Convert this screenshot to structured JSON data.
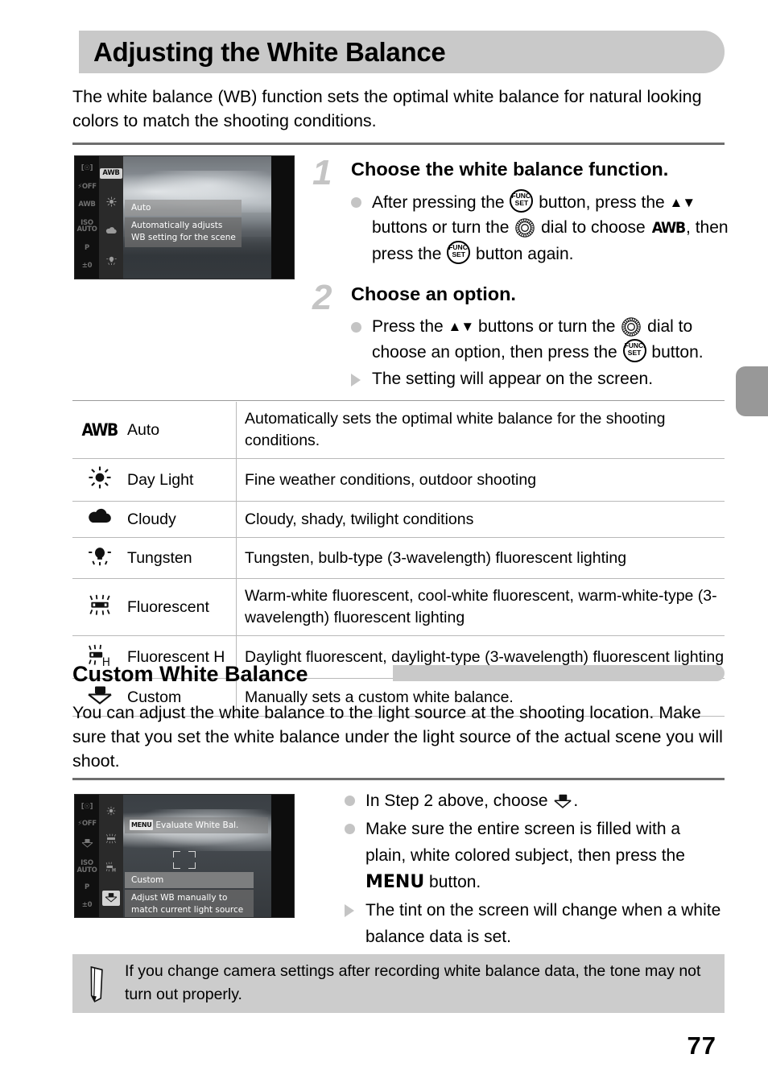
{
  "header": {
    "title": "Adjusting the White Balance",
    "intro": "The white balance (WB) function sets the optimal white balance for natural looking colors to match the shooting conditions."
  },
  "camera_screen_1": {
    "left_column_icons": [
      "metering-icon",
      "flash-off-icon",
      "awb-icon",
      "iso-auto-icon",
      "P",
      "±0"
    ],
    "left_column_labels": [
      "[*]",
      "OFF",
      "AWB",
      "ISO AUTO",
      "P",
      "±0"
    ],
    "selected_column_labels": [
      "AWB",
      "daylight-icon",
      "cloudy-icon",
      "tungsten-icon"
    ],
    "highlighted": "AWB",
    "option_label": "Auto",
    "option_description_line1": "Automatically adjusts",
    "option_description_line2": "WB setting for the scene"
  },
  "camera_screen_2": {
    "left_column_labels": [
      "[*]",
      "OFF",
      "custom-icon",
      "ISO AUTO",
      "P",
      "±0"
    ],
    "selected_column_labels": [
      "daylight-icon",
      "fluorescent-icon",
      "fluorescent-h-icon",
      "custom-icon"
    ],
    "highlighted": "custom-icon",
    "menu_chip": "MENU",
    "menu_bar_text": "Evaluate White Bal.",
    "option_label": "Custom",
    "option_description_line1": "Adjust WB manually to",
    "option_description_line2": "match current light source"
  },
  "steps": [
    {
      "number": "1",
      "title": "Choose the white balance function.",
      "lines": [
        {
          "marker": "dot",
          "segments": [
            {
              "t": "text",
              "v": "After pressing the "
            },
            {
              "t": "func",
              "v": "FUNC./SET"
            },
            {
              "t": "text",
              "v": " button, press the "
            },
            {
              "t": "arrows",
              "v": "▲▼"
            },
            {
              "t": "text",
              "v": " buttons or turn the "
            },
            {
              "t": "dial",
              "v": "control-dial"
            },
            {
              "t": "text",
              "v": " dial to choose "
            },
            {
              "t": "awb",
              "v": "AWB"
            },
            {
              "t": "text",
              "v": ", then press the "
            },
            {
              "t": "func",
              "v": "FUNC./SET"
            },
            {
              "t": "text",
              "v": " button again."
            }
          ]
        }
      ]
    },
    {
      "number": "2",
      "title": "Choose an option.",
      "lines": [
        {
          "marker": "dot",
          "segments": [
            {
              "t": "text",
              "v": "Press the "
            },
            {
              "t": "arrows",
              "v": "▲▼"
            },
            {
              "t": "text",
              "v": " buttons or turn the "
            },
            {
              "t": "dial",
              "v": "control-dial"
            },
            {
              "t": "text",
              "v": " dial to choose an option, then press the "
            },
            {
              "t": "func",
              "v": "FUNC./SET"
            },
            {
              "t": "text",
              "v": " button."
            }
          ]
        },
        {
          "marker": "triangle",
          "segments": [
            {
              "t": "text",
              "v": "The setting will appear on the screen."
            }
          ]
        }
      ]
    }
  ],
  "wb_table": {
    "rows": [
      {
        "icon": "awb-icon",
        "name": "Auto",
        "desc": "Automatically sets the optimal white balance for the shooting conditions."
      },
      {
        "icon": "daylight-icon",
        "name": "Day Light",
        "desc": "Fine weather conditions, outdoor shooting"
      },
      {
        "icon": "cloudy-icon",
        "name": "Cloudy",
        "desc": "Cloudy, shady, twilight conditions"
      },
      {
        "icon": "tungsten-icon",
        "name": "Tungsten",
        "desc": "Tungsten, bulb-type (3-wavelength) fluorescent lighting"
      },
      {
        "icon": "fluorescent-icon",
        "name": "Fluorescent",
        "desc": "Warm-white fluorescent, cool-white fluorescent, warm-white-type (3-wavelength) fluorescent lighting"
      },
      {
        "icon": "fluorescent-h-icon",
        "name": "Fluorescent H",
        "desc": "Daylight fluorescent, daylight-type (3-wavelength) fluorescent lighting"
      },
      {
        "icon": "custom-icon",
        "name": "Custom",
        "desc": "Manually sets a custom white balance."
      }
    ]
  },
  "section2": {
    "heading": "Custom White Balance",
    "paragraph": "You can adjust the white balance to the light source at the shooting location. Make sure that you set the white balance under the light source of the actual scene you will shoot.",
    "bullets": [
      {
        "marker": "dot",
        "segments": [
          {
            "t": "text",
            "v": "In Step 2 above, choose "
          },
          {
            "t": "custom",
            "v": "custom-wb-icon"
          },
          {
            "t": "text",
            "v": "."
          }
        ]
      },
      {
        "marker": "dot",
        "segments": [
          {
            "t": "text",
            "v": "Make sure the entire screen is filled with a plain, white colored subject, then press the "
          },
          {
            "t": "menu",
            "v": "MENU"
          },
          {
            "t": "text",
            "v": " button."
          }
        ]
      },
      {
        "marker": "triangle",
        "segments": [
          {
            "t": "text",
            "v": "The tint on the screen will change when a white balance data is set."
          }
        ]
      }
    ]
  },
  "note": {
    "icon": "pencil-icon",
    "text": "If you change camera settings after recording white balance data, the tone may not turn out properly."
  },
  "page_number": "77",
  "colors": {
    "header_bar": "#c9c9c9",
    "note_bg": "#cccccc",
    "step_number": "#c4c4c4",
    "rule": "#6e6e6e",
    "edge_tab": "#989898"
  }
}
